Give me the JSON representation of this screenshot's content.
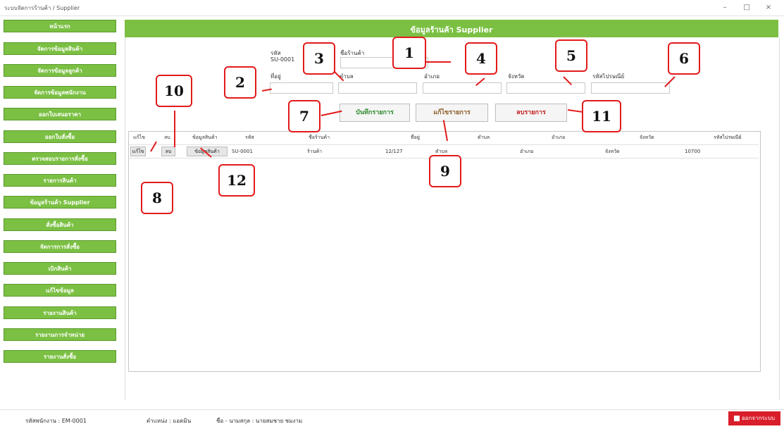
{
  "window": {
    "title": "ระบบจัดการร้านค้า / Supplier"
  },
  "header": {
    "title": "ข้อมูลร้านค้า Supplier"
  },
  "sidebar": {
    "items": [
      "หน้าแรก",
      "จัดการข้อมูลสินค้า",
      "จัดการข้อมูลลูกค้า",
      "จัดการข้อมูลพนักงาน",
      "ออกใบเสนอราคา",
      "ออกใบสั่งซื้อ",
      "ตรวจสอบรายการสั่งซื้อ",
      "รายการสินค้า",
      "ข้อมูลร้านค้า Supplier",
      "สั่งซื้อสินค้า",
      "จัดการการสั่งซื้อ",
      "เบิกสินค้า",
      "แก้ไขข้อมูล",
      "รายงานสินค้า",
      "รายงานการจำหน่าย",
      "รายงานสั่งซื้อ"
    ]
  },
  "form": {
    "code_label": "รหัส",
    "code_value": "SU-0001",
    "shop_label": "ชื่อร้านค้า",
    "no_label": "ที่อยู่",
    "district_label": "ตำบล",
    "amphoe_label": "อำเภอ",
    "province_label": "จังหวัด",
    "postcode_label": "รหัสไปรษณีย์"
  },
  "buttons": {
    "save": "บันทึกรายการ",
    "edit": "แก้ไขรายการ",
    "delete": "ลบรายการ"
  },
  "grid": {
    "headers": [
      "แก้ไข",
      "ลบ",
      "ข้อมูลสินค้า",
      "รหัส",
      "ชื่อร้านค้า",
      "ที่อยู่",
      "ตำบล",
      "อำเภอ",
      "จังหวัด",
      "รหัสไปรษณีย์"
    ],
    "rows": [
      {
        "edit": "แก้ไข",
        "delete": "ลบ",
        "info": "ข้อมูลสินค้า",
        "code": "SU-0001",
        "shop": "ร้านค้า",
        "no": "12/127",
        "district": "ตำบล",
        "amphoe": "อำเภอ",
        "province": "จังหวัด",
        "postcode": "10700"
      }
    ]
  },
  "callouts": [
    "1",
    "2",
    "3",
    "4",
    "5",
    "6",
    "7",
    "8",
    "9",
    "10",
    "11",
    "12"
  ],
  "status": {
    "emp_code_label": "รหัสพนักงาน : EM-0001",
    "position": "ตำแหน่ง : แอดมิน",
    "name": "ชื่อ - นามสกุล : นายสมชาย ชมงาม",
    "logout": "ออกจากระบบ"
  },
  "colors": {
    "accent": "#7bc043",
    "callout": "#e21b1b",
    "logout": "#d81e2a"
  }
}
